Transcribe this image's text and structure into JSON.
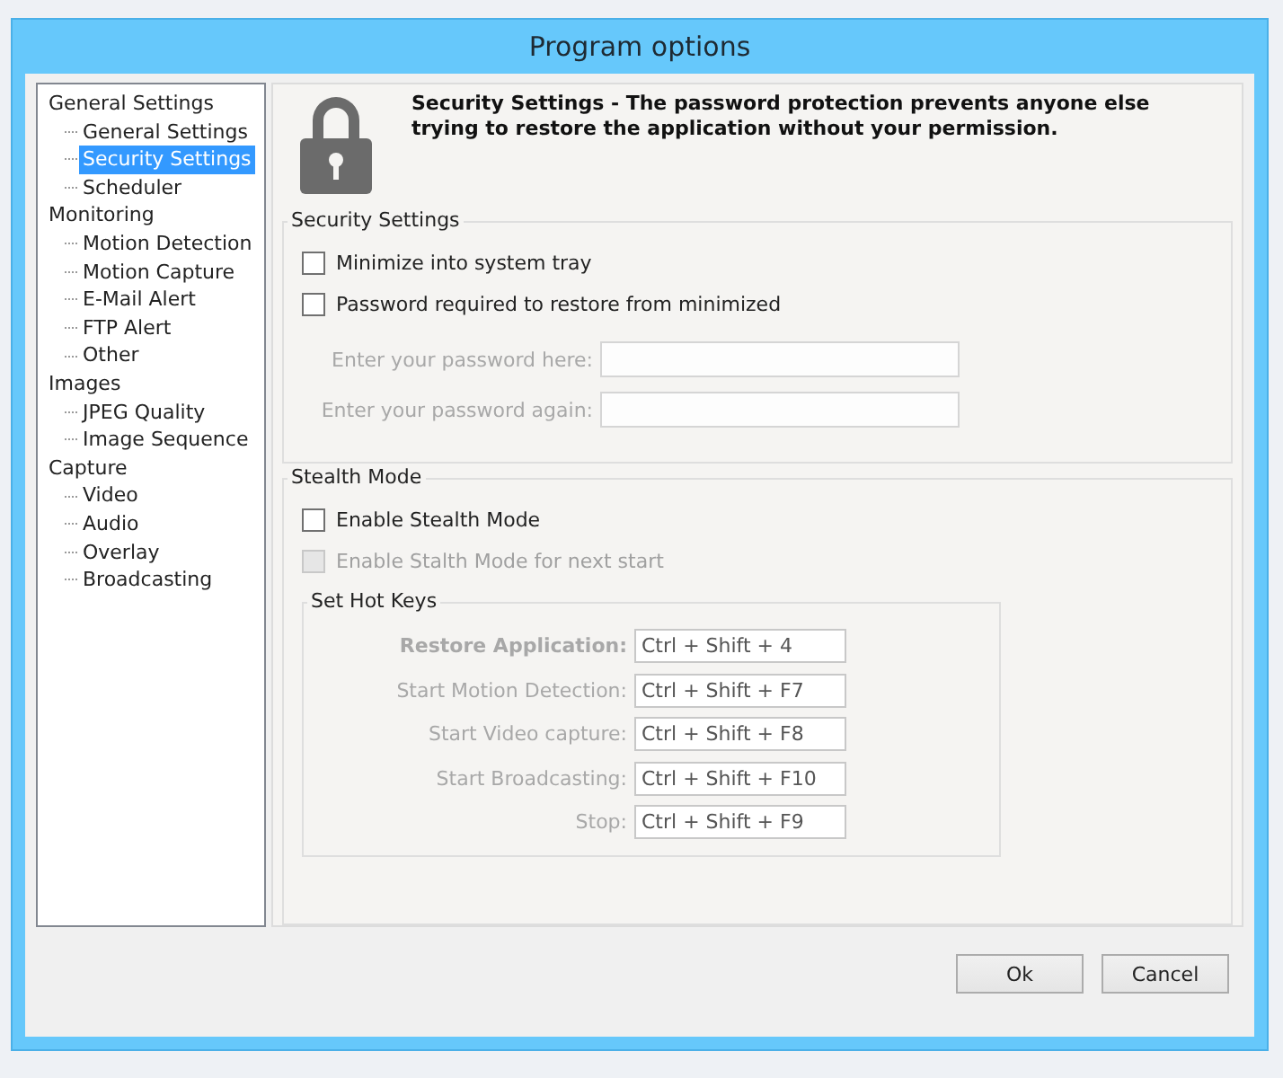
{
  "window": {
    "title": "Program options"
  },
  "sidebar": {
    "items": [
      {
        "label": "General Settings",
        "selected": false,
        "children": [
          {
            "label": "General Settings",
            "selected": false
          },
          {
            "label": "Security Settings",
            "selected": true
          },
          {
            "label": "Scheduler",
            "selected": false
          }
        ]
      },
      {
        "label": "Monitoring",
        "selected": false,
        "children": [
          {
            "label": "Motion Detection",
            "selected": false
          },
          {
            "label": "Motion Capture",
            "selected": false
          },
          {
            "label": "E-Mail Alert",
            "selected": false
          },
          {
            "label": "FTP Alert",
            "selected": false
          },
          {
            "label": "Other",
            "selected": false
          }
        ]
      },
      {
        "label": "Images",
        "selected": false,
        "children": [
          {
            "label": "JPEG Quality",
            "selected": false
          },
          {
            "label": "Image Sequence",
            "selected": false
          }
        ]
      },
      {
        "label": "Capture",
        "selected": false,
        "children": [
          {
            "label": "Video",
            "selected": false
          },
          {
            "label": "Audio",
            "selected": false
          },
          {
            "label": "Overlay",
            "selected": false
          },
          {
            "label": "Broadcasting",
            "selected": false
          }
        ]
      }
    ]
  },
  "header": {
    "text": "Security Settings - The password protection prevents anyone else trying to restore the application without your permission."
  },
  "security": {
    "title": "Security Settings",
    "checkboxes": [
      {
        "label": "Minimize into system tray",
        "checked": false,
        "disabled": false
      },
      {
        "label": "Password required to restore from minimized",
        "checked": false,
        "disabled": false
      }
    ],
    "fields": [
      {
        "label": "Enter your password here:",
        "disabled": true
      },
      {
        "label": "Enter your password again:",
        "disabled": true
      }
    ]
  },
  "stealth": {
    "title": "Stealth Mode",
    "checkboxes": [
      {
        "label": "Enable Stealth Mode",
        "checked": false,
        "disabled": false
      },
      {
        "label": "Enable Stalth Mode for next start",
        "checked": false,
        "disabled": true
      }
    ],
    "hotkeys": {
      "title": "Set Hot Keys",
      "rows": [
        {
          "label": "Restore Application:",
          "value": "Ctrl + Shift + 4",
          "bold": true
        },
        {
          "label": "Start Motion Detection:",
          "value": "Ctrl + Shift + F7",
          "bold": false
        },
        {
          "label": "Start Video capture:",
          "value": "Ctrl + Shift + F8",
          "bold": false
        },
        {
          "label": "Start Broadcasting:",
          "value": "Ctrl + Shift + F10",
          "bold": false
        },
        {
          "label": "Stop:",
          "value": "Ctrl + Shift + F9",
          "bold": false
        }
      ]
    }
  },
  "buttons": [
    "Ok",
    "Cancel"
  ]
}
